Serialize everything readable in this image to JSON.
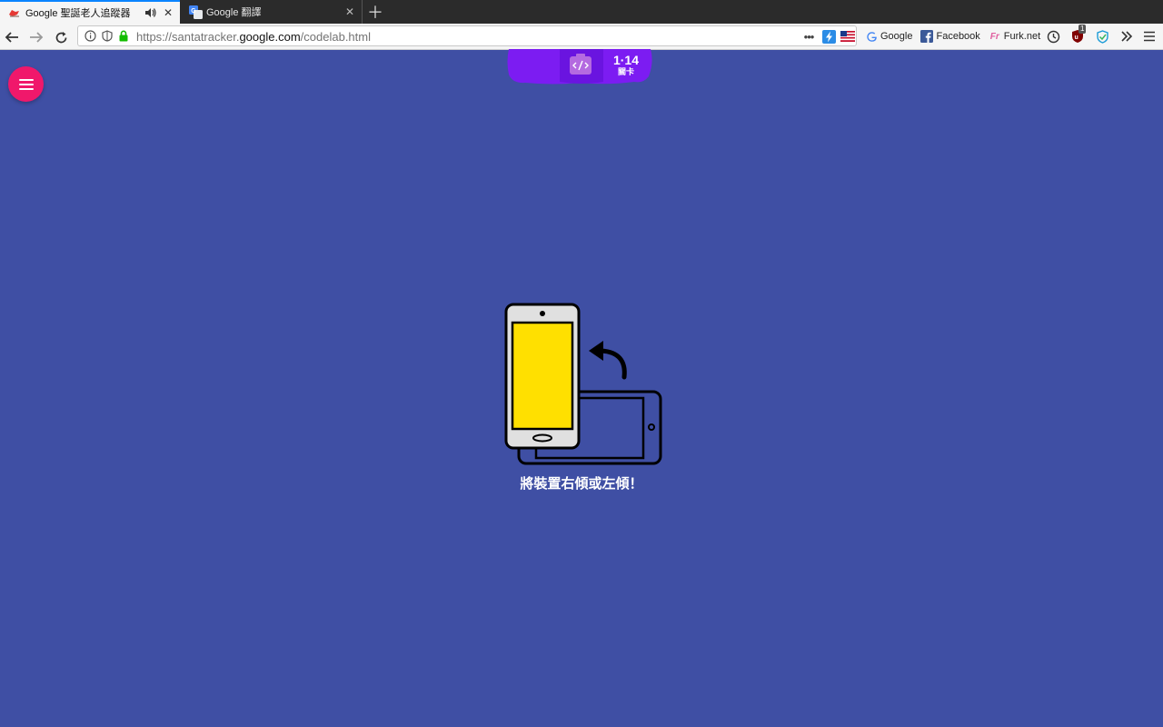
{
  "browser": {
    "tabs": [
      {
        "title": "Google 聖誕老人追蹤器",
        "active": true,
        "favicon": "santa-sleigh-icon",
        "has_audio": true
      },
      {
        "title": "Google 翻譯",
        "active": false,
        "favicon": "google-translate-icon"
      }
    ],
    "url": {
      "prefix": "https://santatracker.",
      "domain": "google.com",
      "path": "/codelab.html"
    },
    "bookmarks": [
      {
        "label": "Google",
        "icon": "google-g-icon"
      },
      {
        "label": "Facebook",
        "icon": "facebook-icon"
      },
      {
        "label": "Furk.net",
        "icon": "furk-icon"
      }
    ],
    "extension_badge": "1"
  },
  "page": {
    "level": {
      "number": "1·14",
      "label": "關卡"
    },
    "message": "將裝置右傾或左傾！",
    "colors": {
      "background": "#3f4fa4",
      "menu_button": "#f0186b",
      "level_bar": "#7c1cf2",
      "phone_screen": "#ffe000"
    }
  }
}
